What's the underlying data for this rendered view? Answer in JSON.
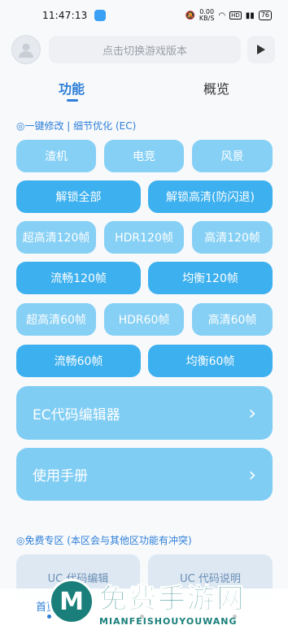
{
  "status": {
    "time": "11:47:13",
    "speed_value": "0.00",
    "speed_unit": "KB/S",
    "hd": "HD",
    "battery": "76"
  },
  "header": {
    "search_placeholder": "点击切换游戏版本"
  },
  "tabs": [
    {
      "label": "功能"
    },
    {
      "label": "概览"
    }
  ],
  "section1": {
    "title": "◎一键修改 | 细节优化 (EC)"
  },
  "buttons": [
    {
      "label": "渣机"
    },
    {
      "label": "电竞"
    },
    {
      "label": "风景"
    },
    {
      "label": "解锁全部"
    },
    {
      "label": "解锁高清(防闪退)"
    },
    {
      "label": "超高清120帧"
    },
    {
      "label": "HDR120帧"
    },
    {
      "label": "高清120帧"
    },
    {
      "label": "流畅120帧"
    },
    {
      "label": "均衡120帧"
    },
    {
      "label": "超高清60帧"
    },
    {
      "label": "HDR60帧"
    },
    {
      "label": "高清60帧"
    },
    {
      "label": "流畅60帧"
    },
    {
      "label": "均衡60帧"
    }
  ],
  "big_buttons": [
    {
      "label": "EC代码编辑器"
    },
    {
      "label": "使用手册"
    }
  ],
  "section2": {
    "title": "◎免费专区 (本区会与其他区功能有冲突)"
  },
  "free_cards": [
    {
      "label": "UC 代码编辑"
    },
    {
      "label": "UC 代码说明"
    }
  ],
  "bottom_nav": {
    "home": "首页"
  },
  "watermark": {
    "main": "免费手游网",
    "sub": "MIANFEISHOUYOUWANG"
  }
}
